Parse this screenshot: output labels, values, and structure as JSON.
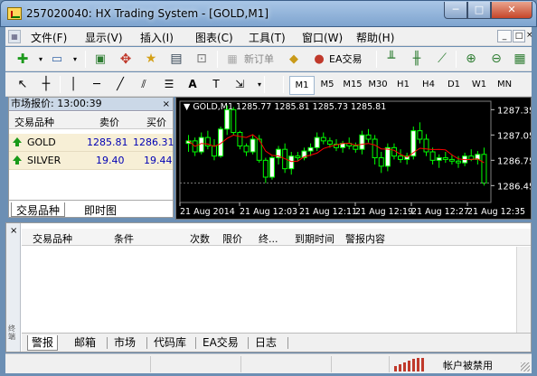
{
  "window": {
    "title": "257020040: HX Trading System - [GOLD,M1]",
    "min_label": "─",
    "max_label": "□",
    "close_label": "✕"
  },
  "menu": {
    "items": [
      "文件(F)",
      "显示(V)",
      "插入(I)",
      "图表(C)",
      "工具(T)",
      "窗口(W)",
      "帮助(H)"
    ],
    "mdi_buttons": [
      "_",
      "□",
      "×"
    ]
  },
  "toolbar": {
    "new_order_label": "新订单",
    "ea_label": "EA交易"
  },
  "timeframes": {
    "items": [
      "M1",
      "M5",
      "M15",
      "M30",
      "H1",
      "H4",
      "D1",
      "W1",
      "MN"
    ],
    "active": "M1"
  },
  "market_watch": {
    "header": "市场报价: 13:00:39",
    "close_label": "×",
    "columns": [
      "交易品种",
      "卖价",
      "买价"
    ],
    "rows": [
      {
        "symbol": "GOLD",
        "bid": "1285.81",
        "ask": "1286.31"
      },
      {
        "symbol": "SILVER",
        "bid": "19.40",
        "ask": "19.44"
      }
    ],
    "tabs": [
      "交易品种",
      "即时图"
    ]
  },
  "chart_data": {
    "type": "candlestick",
    "header": "GOLD,M1  1285.77 1285.81 1285.73 1285.81",
    "ylim": [
      1286.25,
      1287.45
    ],
    "y_ticks": [
      "1287.35",
      "1287.05",
      "1286.75",
      "1286.45"
    ],
    "y_tick_values": [
      1287.35,
      1287.05,
      1286.75,
      1286.45
    ],
    "x_ticks": [
      "21 Aug 2014",
      "21 Aug 12:03",
      "21 Aug 12:11",
      "21 Aug 12:19",
      "21 Aug 12:27",
      "21 Aug 12:35"
    ],
    "colors": {
      "up": "#ffffff",
      "down": "#000000",
      "wick": "#00ff00",
      "ma": "#ff0000",
      "grid": "#3a3a3a"
    },
    "candles": [
      [
        1286.95,
        1287.05,
        1286.85,
        1286.98
      ],
      [
        1286.98,
        1287.02,
        1286.8,
        1286.85
      ],
      [
        1286.85,
        1287.08,
        1286.82,
        1287.02
      ],
      [
        1287.02,
        1287.1,
        1286.88,
        1286.92
      ],
      [
        1286.92,
        1287.0,
        1286.75,
        1286.8
      ],
      [
        1286.8,
        1287.15,
        1286.78,
        1287.12
      ],
      [
        1287.12,
        1287.4,
        1287.05,
        1287.35
      ],
      [
        1287.35,
        1287.38,
        1287.05,
        1287.08
      ],
      [
        1287.08,
        1287.1,
        1286.88,
        1286.92
      ],
      [
        1286.92,
        1286.95,
        1286.8,
        1286.85
      ],
      [
        1286.85,
        1287.05,
        1286.82,
        1287.0
      ],
      [
        1287.0,
        1287.05,
        1286.72,
        1286.75
      ],
      [
        1286.75,
        1286.78,
        1286.48,
        1286.55
      ],
      [
        1286.55,
        1286.8,
        1286.52,
        1286.78
      ],
      [
        1286.78,
        1286.92,
        1286.7,
        1286.88
      ],
      [
        1286.88,
        1286.95,
        1286.6,
        1286.65
      ],
      [
        1286.65,
        1286.85,
        1286.58,
        1286.8
      ],
      [
        1286.8,
        1286.85,
        1286.74,
        1286.78
      ],
      [
        1286.78,
        1286.9,
        1286.75,
        1286.86
      ],
      [
        1286.86,
        1286.95,
        1286.8,
        1286.9
      ],
      [
        1286.9,
        1287.08,
        1286.86,
        1287.02
      ],
      [
        1287.02,
        1287.08,
        1286.94,
        1286.98
      ],
      [
        1286.98,
        1287.02,
        1286.9,
        1286.94
      ],
      [
        1286.94,
        1287.0,
        1286.86,
        1286.9
      ],
      [
        1286.9,
        1286.98,
        1286.84,
        1286.95
      ],
      [
        1286.95,
        1287.02,
        1286.88,
        1286.92
      ],
      [
        1286.92,
        1286.96,
        1286.84,
        1286.88
      ],
      [
        1286.88,
        1287.1,
        1286.82,
        1287.05
      ],
      [
        1287.05,
        1287.12,
        1286.96,
        1287.0
      ],
      [
        1287.0,
        1287.05,
        1286.7,
        1286.78
      ],
      [
        1286.78,
        1286.85,
        1286.6,
        1286.68
      ],
      [
        1286.68,
        1286.95,
        1286.62,
        1286.9
      ],
      [
        1286.9,
        1286.95,
        1286.76,
        1286.8
      ],
      [
        1286.8,
        1286.88,
        1286.72,
        1286.76
      ],
      [
        1286.76,
        1286.84,
        1286.7,
        1286.8
      ],
      [
        1286.8,
        1287.15,
        1286.76,
        1287.1
      ],
      [
        1287.1,
        1287.2,
        1286.95,
        1287.0
      ],
      [
        1287.0,
        1287.06,
        1286.8,
        1286.85
      ],
      [
        1286.85,
        1286.9,
        1286.7,
        1286.75
      ],
      [
        1286.75,
        1286.82,
        1286.66,
        1286.78
      ],
      [
        1286.78,
        1286.85,
        1286.72,
        1286.76
      ],
      [
        1286.76,
        1286.82,
        1286.7,
        1286.74
      ],
      [
        1286.74,
        1286.8,
        1286.66,
        1286.72
      ],
      [
        1286.72,
        1286.84,
        1286.68,
        1286.8
      ],
      [
        1286.8,
        1286.88,
        1286.74,
        1286.76
      ],
      [
        1286.76,
        1286.86,
        1286.7,
        1286.82
      ],
      [
        1286.82,
        1286.9,
        1286.45,
        1286.48
      ]
    ]
  },
  "terminal": {
    "side_label": "终端",
    "close_label": "×",
    "columns": [
      "交易品种",
      "条件",
      "次数",
      "限价",
      "终...",
      "到期时间",
      "警报内容"
    ],
    "tabs": [
      "警报",
      "邮箱",
      "市场",
      "代码库",
      "EA交易",
      "日志"
    ],
    "active_tab": "警报"
  },
  "status": {
    "account_text": "帐户被禁用"
  }
}
